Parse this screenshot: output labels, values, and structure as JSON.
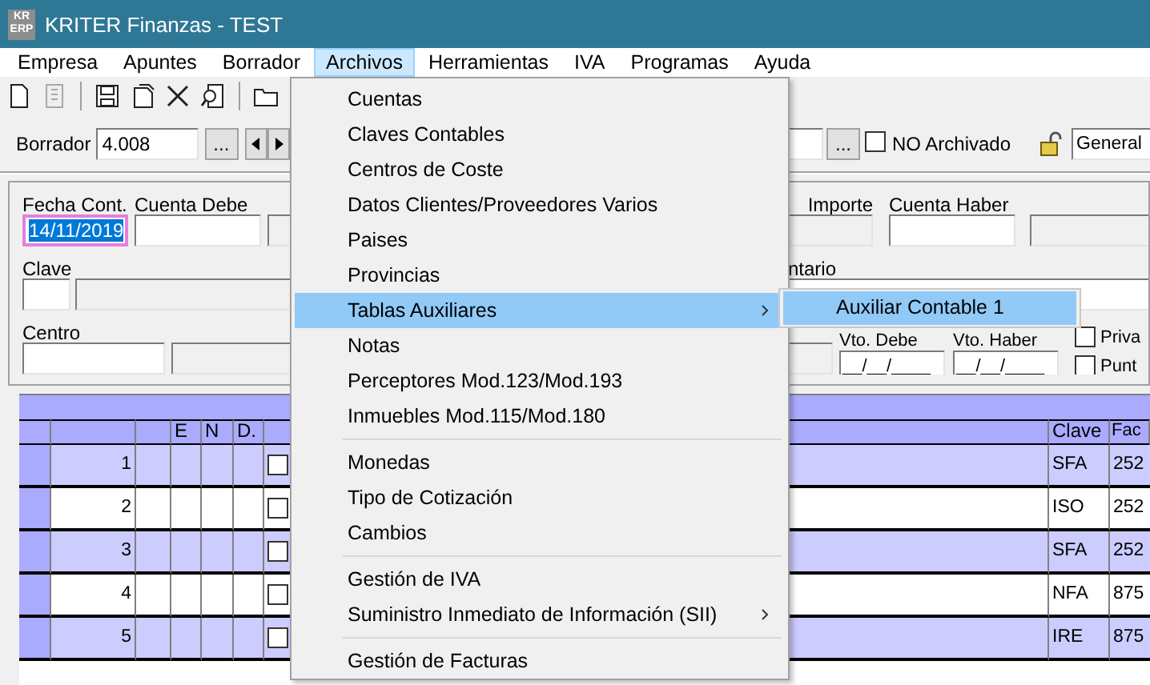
{
  "window": {
    "title": "KRITER Finanzas - TEST",
    "logo": [
      "KR",
      "ERP"
    ]
  },
  "menubar": [
    {
      "label": "Empresa",
      "selected": false
    },
    {
      "label": "Apuntes",
      "selected": false
    },
    {
      "label": "Borrador",
      "selected": false
    },
    {
      "label": "Archivos",
      "selected": true
    },
    {
      "label": "Herramientas",
      "selected": false
    },
    {
      "label": "IVA",
      "selected": false
    },
    {
      "label": "Programas",
      "selected": false
    },
    {
      "label": "Ayuda",
      "selected": false
    }
  ],
  "toolbar": [
    {
      "kind": "new",
      "disabled": false
    },
    {
      "kind": "report",
      "disabled": true
    },
    {
      "kind": "separator"
    },
    {
      "kind": "save",
      "disabled": false
    },
    {
      "kind": "copy",
      "disabled": false
    },
    {
      "kind": "delete",
      "disabled": false
    },
    {
      "kind": "preview",
      "disabled": false
    },
    {
      "kind": "separator"
    },
    {
      "kind": "folder",
      "disabled": false
    }
  ],
  "borrador": {
    "label": "Borrador",
    "value": "4.008",
    "browse": "...",
    "browse_right": "...",
    "archived": {
      "label": "NO Archivado",
      "checked": false
    },
    "journal": "General"
  },
  "form": {
    "fecha": {
      "label": "Fecha Cont.",
      "value": "14/11/2019",
      "selected": true
    },
    "cuenta_debe": {
      "label": "Cuenta Debe"
    },
    "importe": {
      "label": "Importe"
    },
    "cuenta_haber": {
      "label": "Cuenta Haber"
    },
    "clave": {
      "label": "Clave"
    },
    "comentario": {
      "label": "ntario"
    },
    "centro": {
      "label": "Centro"
    },
    "vto_debe": {
      "label": "Vto. Debe",
      "value": "__/__/____"
    },
    "vto_haber": {
      "label": "Vto. Haber",
      "value": "__/__/____"
    },
    "checkboxes": [
      {
        "label": "Priva",
        "checked": false
      },
      {
        "label": "Punt",
        "checked": false
      }
    ]
  },
  "grid": {
    "columns": [
      "E",
      "N",
      "D.",
      "Clave",
      "Fac"
    ],
    "rows": [
      {
        "number": "1",
        "checked": false,
        "clave": "SFA",
        "fac": "252"
      },
      {
        "number": "2",
        "checked": false,
        "clave": "ISO",
        "fac": "252"
      },
      {
        "number": "3",
        "checked": false,
        "clave": "SFA",
        "fac": "252"
      },
      {
        "number": "4",
        "checked": false,
        "clave": "NFA",
        "fac": "875"
      },
      {
        "number": "5",
        "checked": false,
        "clave": "IRE",
        "fac": "875"
      }
    ]
  },
  "menu": {
    "items": [
      {
        "kind": "item",
        "label": "Cuentas",
        "selected": false,
        "submenu": false
      },
      {
        "kind": "item",
        "label": "Claves Contables",
        "selected": false,
        "submenu": false
      },
      {
        "kind": "item",
        "label": "Centros de Coste",
        "selected": false,
        "submenu": false
      },
      {
        "kind": "item",
        "label": "Datos Clientes/Proveedores Varios",
        "selected": false,
        "submenu": false
      },
      {
        "kind": "item",
        "label": "Paises",
        "selected": false,
        "submenu": false
      },
      {
        "kind": "item",
        "label": "Provincias",
        "selected": false,
        "submenu": false
      },
      {
        "kind": "item",
        "label": "Tablas Auxiliares",
        "selected": true,
        "submenu": true
      },
      {
        "kind": "item",
        "label": "Notas",
        "selected": false,
        "submenu": false
      },
      {
        "kind": "item",
        "label": "Perceptores Mod.123/Mod.193",
        "selected": false,
        "submenu": false
      },
      {
        "kind": "item",
        "label": "Inmuebles Mod.115/Mod.180",
        "selected": false,
        "submenu": false
      },
      {
        "kind": "separator"
      },
      {
        "kind": "item",
        "label": "Monedas",
        "selected": false,
        "submenu": false
      },
      {
        "kind": "item",
        "label": "Tipo de Cotización",
        "selected": false,
        "submenu": false
      },
      {
        "kind": "item",
        "label": "Cambios",
        "selected": false,
        "submenu": false
      },
      {
        "kind": "separator"
      },
      {
        "kind": "item",
        "label": "Gestión de IVA",
        "selected": false,
        "submenu": false
      },
      {
        "kind": "item",
        "label": "Suministro Inmediato de Información (SII)",
        "selected": false,
        "submenu": true
      },
      {
        "kind": "separator"
      },
      {
        "kind": "item",
        "label": "Gestión de Facturas",
        "selected": false,
        "submenu": false
      }
    ],
    "submenu": [
      {
        "label": "Auxiliar Contable 1",
        "selected": true
      }
    ]
  }
}
